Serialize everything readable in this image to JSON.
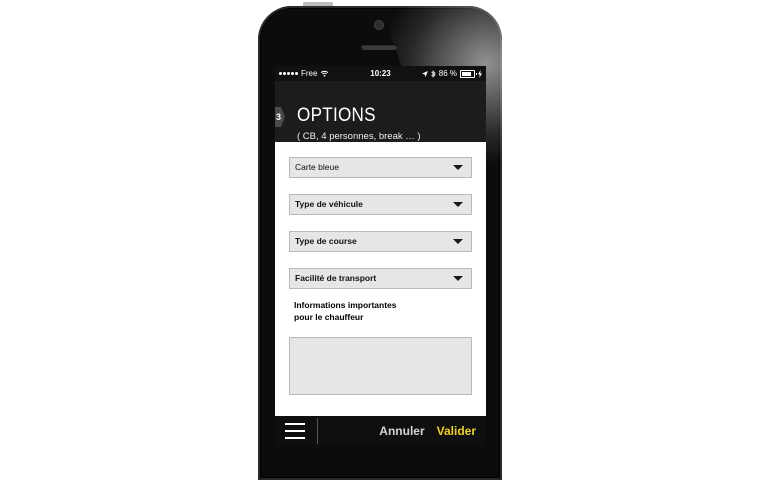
{
  "status_bar": {
    "carrier": "Free",
    "time": "10:23",
    "battery": "86 %"
  },
  "header": {
    "step": "3",
    "title": "OPTIONS",
    "subtitle": "( CB, 4 personnes, break … )"
  },
  "form": {
    "payment": "Carte bleue",
    "vehicle_type": "Type de véhicule",
    "ride_type": "Type de course",
    "transport_facility": "Facilité de transport",
    "info_label_line1": "Informations importantes",
    "info_label_line2": "pour le chauffeur",
    "info_value": ""
  },
  "footer": {
    "cancel": "Annuler",
    "validate": "Valider"
  },
  "colors": {
    "accent": "#f0d21c",
    "header_bg": "#1c1c1c",
    "field_bg": "#e6e6e6"
  },
  "icons": [
    "signal-dots-icon",
    "wifi-icon",
    "location-arrow-icon",
    "bluetooth-icon",
    "battery-icon",
    "charging-icon",
    "dropdown-arrow-icon",
    "hamburger-menu-icon"
  ]
}
